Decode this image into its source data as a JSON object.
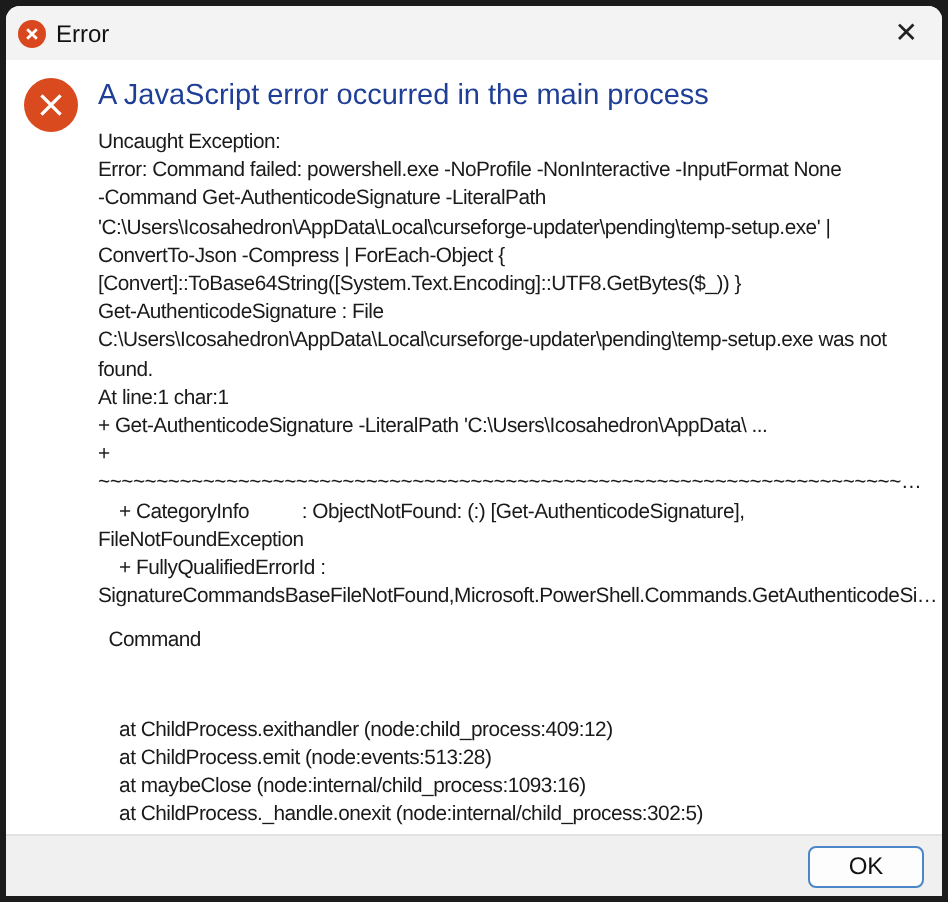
{
  "window": {
    "title": "Error",
    "close_symbol": "✕"
  },
  "heading": "A JavaScript error occurred in the main process",
  "message_blocks": [
    {
      "lines": [
        "Uncaught Exception:",
        "Error: Command failed: powershell.exe -NoProfile -NonInteractive -InputFormat None",
        "-Command Get-AuthenticodeSignature -LiteralPath",
        "'C:\\Users\\Icosahedron\\AppData\\Local\\curseforge-updater\\pending\\temp-setup.exe' |",
        "ConvertTo-Json -Compress | ForEach-Object {",
        "[Convert]::ToBase64String([System.Text.Encoding]::UTF8.GetBytes($_)) }",
        "Get-AuthenticodeSignature : File",
        "C:\\Users\\Icosahedron\\AppData\\Local\\curseforge-updater\\pending\\temp-setup.exe was not",
        "found.",
        "At line:1 char:1",
        "+ Get-AuthenticodeSignature -LiteralPath 'C:\\Users\\Icosahedron\\AppData\\ ...",
        "+",
        "~~~~~~~~~~~~~~~~~~~~~~~~~~~~~~~~~~~~~~~~~~~~~~~~~~~~~~~~~~~~~~~~~~~~~…",
        "    + CategoryInfo          : ObjectNotFound: (:) [Get-AuthenticodeSignature],",
        "FileNotFoundException",
        "    + FullyQualifiedErrorId :",
        "SignatureCommandsBaseFileNotFound,Microsoft.PowerShell.Commands.GetAuthenticodeSi…"
      ]
    },
    {
      "lines": [
        "  Command"
      ]
    },
    {
      "lines": [
        "    at ChildProcess.exithandler (node:child_process:409:12)",
        "    at ChildProcess.emit (node:events:513:28)",
        "    at maybeClose (node:internal/child_process:1093:16)",
        "    at ChildProcess._handle.onexit (node:internal/child_process:302:5)"
      ]
    }
  ],
  "buttons": [
    {
      "label": "OK",
      "default": true
    }
  ]
}
